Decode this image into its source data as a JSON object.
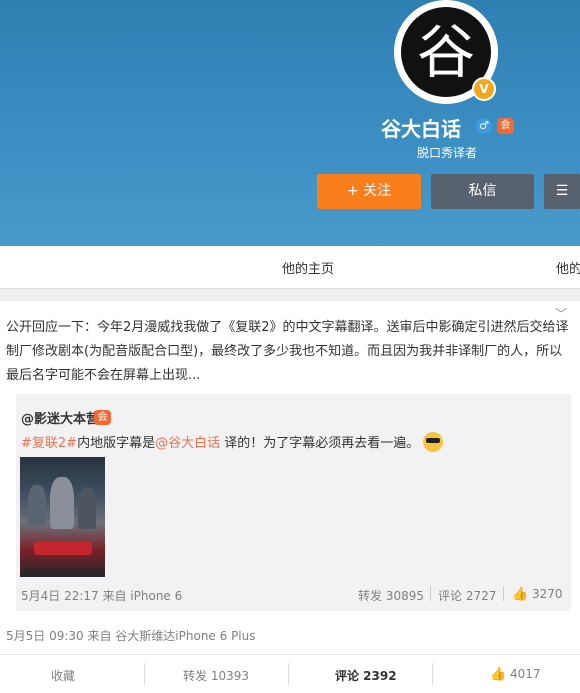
{
  "profile": {
    "avatar_char": "谷",
    "verified_badge": "V",
    "name": "谷大白话",
    "gender_icon": "♂",
    "member_icon": "会",
    "bio": "脱口秀译者"
  },
  "buttons": {
    "follow": "+ 关注",
    "message": "私信",
    "more": "☰"
  },
  "nav": {
    "home": "他的主页",
    "other": "他的"
  },
  "post": {
    "expand_icon": "﹀",
    "text": "公开回应一下：今年2月漫威找我做了《复联2》的中文字幕翻译。送审后中影确定引进然后交给译制厂修改剧本(为配音版配合口型)，最终改了多少我也不知道。而且因为我并非译制厂的人，所以最后名字可能不会在屏幕上出现...",
    "meta": "5月5日 09:30 来自 谷大斯维达iPhone 6 Plus",
    "actions": {
      "favorite": "收藏",
      "repost": "转发 10393",
      "comment": "评论 2392",
      "like": "4017"
    }
  },
  "quoted": {
    "author": "@影迷大本营",
    "badge": "会",
    "hashtag": "#复联2#",
    "text_mid": "内地版字幕是",
    "mention": "@谷大白话",
    "text_end": " 译的！为了字幕必须再去看一遍。",
    "meta": "5月4日 22:17 来自 iPhone 6",
    "repost": "转发 30895",
    "comment": "评论 2727",
    "like": "3270"
  },
  "colors": {
    "accent": "#fb7e1c",
    "link": "#eb7350",
    "cover": "#3b8ec2",
    "dark_button": "#57626e"
  }
}
